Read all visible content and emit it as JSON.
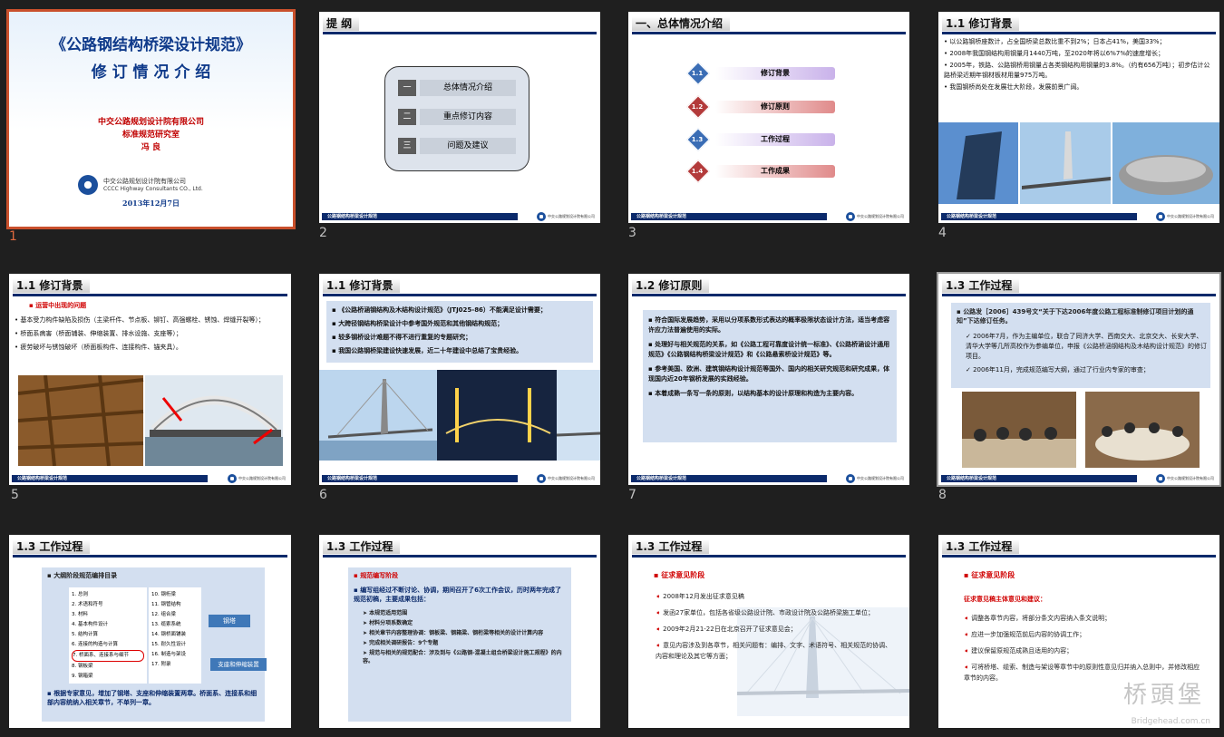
{
  "slides": [
    {
      "num": "1",
      "title": "《公路钢结构桥梁设计规范》",
      "subtitle": "修 订 情 况 介 绍",
      "org1": "中交公路规划设计院有限公司",
      "org2": "标准规范研究室",
      "author": "冯  良",
      "logo_cn": "中交公路规划设计院有限公司",
      "logo_en": "CCCC Highway Consultants CO., Ltd.",
      "date": "2013年12月7日"
    },
    {
      "num": "2",
      "title": "提   纲",
      "items": [
        {
          "n": "一",
          "t": "总体情况介绍"
        },
        {
          "n": "二",
          "t": "重点修订内容"
        },
        {
          "n": "三",
          "t": "问题及建议"
        }
      ]
    },
    {
      "num": "3",
      "title": "一、总体情况介绍",
      "items": [
        {
          "n": "1.1",
          "t": "修订背景"
        },
        {
          "n": "1.2",
          "t": "修订原则"
        },
        {
          "n": "1.3",
          "t": "工作过程"
        },
        {
          "n": "1.4",
          "t": "工作成果"
        }
      ]
    },
    {
      "num": "4",
      "title": "1.1 修订背景",
      "bullets": [
        "以公路钢桥座数计，占全国桥梁总数比重不到2%；日本占41%，美国33%；",
        "2008年我国钢结构用钢量月1440万吨，至2020年将以6%7%的速度增长；",
        "2005年，铁路、公路钢桥用钢量占各类钢结构用钢量的3.8%。（约有656万吨）；初步估计公路桥梁近期年钢材板材用量975万吨。",
        "我国钢桥尚处在发展壮大阶段，发展前景广阔。"
      ]
    },
    {
      "num": "5",
      "title": "1.1 修订背景",
      "head": "运营中出现的问题",
      "bullets": [
        "基本受力构件缺陷及损伤（主梁杆件、节点板、铆钉、高强螺栓、锈蚀、焊缝开裂等）；",
        "桥面系病害（桥面铺装、伸缩装置、排水设施、支座等）；",
        "疲劳破坏与锈蚀破坏（桥面板构件、连接构件、锚夹具）。"
      ]
    },
    {
      "num": "6",
      "title": "1.1 修订背景",
      "bullets": [
        "《公路桥涵钢结构及木结构设计规范》（JTJ025-86）不能满足设计需要；",
        "大跨径钢结构桥梁设计中参考国外规范和其他钢结构规范；",
        "较多钢桥设计难题不得不进行重复的专题研究；",
        "我国公路钢桥梁建设快速发展，近二十年建设中总结了宝贵经验。"
      ]
    },
    {
      "num": "7",
      "title": "1.2 修订原则",
      "bullets": [
        "符合国际发展趋势，采用以分项系数形式表达的概率极限状态设计方法，适当考虑容许应力法普遍使用的实际。",
        "处理好与相关规范的关系，如《公路工程可靠度设计统一标准》、《公路桥涵设计通用规范》《公路钢结构桥梁设计规范》和《公路悬索桥设计规范》等。",
        "参考美国、欧洲、建筑钢结构设计规范等国外、国内的相关研究规范和研究成果，体现国内近20年钢桥发展的实践经验。",
        "本着成熟一条写一条的原则，以结构基本的设计原理和构造为主要内容。"
      ]
    },
    {
      "num": "8",
      "title": "1.3 工作过程",
      "lead": "公路发［2006］439号文“关于下达2006年度公路工程标准制修订项目计划的通知”下达修订任务。",
      "checks": [
        "2006年7月，作为主编单位，联合了同济大学、西南交大、北京交大、长安大学、清华大学等几所高校作为参编单位，申报《公路桥涵钢结构及木结构设计规范》的修订项目。",
        "2006年11月，完成规范编写大纲，通过了行业内专家的审查；"
      ]
    },
    {
      "num": "9",
      "title": "1.3 工作过程",
      "head": "大纲阶段规范编排目录",
      "col1": [
        "1.  总则",
        "2.  术语和符号",
        "3.  材料",
        "4.  基本构件设计",
        "5.  结构计算",
        "6.  连接的构造与计算",
        "7.  桥面系、连接系与细节",
        "8.  钢板梁",
        "9.  钢箱梁"
      ],
      "col2": [
        "10. 钢桁梁",
        "11. 钢管结构",
        "12. 组合梁",
        "13. 缆索系统",
        "14. 钢桥面铺装",
        "15. 耐久性设计",
        "16. 制造与架设",
        "17. 附录"
      ],
      "tag1": "钢塔",
      "tag2": "支座和伸缩装置",
      "note": "根据专家意见，增加了钢塔、支座和伸缩装置两章。桥面系、连接系和细部内容统纳入相关章节，不单列一章。"
    },
    {
      "num": "10",
      "title": "1.3 工作过程",
      "head": "规范编写阶段",
      "lead": "编写组经过不断讨论、协调，期间召开了6次工作会议，历时两年完成了规范初稿，主要成果包括：",
      "items": [
        "本规范适用范围",
        "材料分项系数确定",
        "相关章节内容整理协调：钢板梁、钢箱梁、钢桁梁等相关的设计计算内容",
        "完成相关调研报告：9个专题",
        "规范与相关的规范配合：涉及到与《公路钢-混凝土组合桥梁设计施工规程》的内容。"
      ]
    },
    {
      "num": "11",
      "title": "1.3 工作过程",
      "head": "征求意见阶段",
      "items": [
        "2008年12月发出征求意见稿",
        "发函27家单位，包括各省级公路设计院、市政设计院及公路桥梁施工单位；",
        "2009年2月21-22日在北京召开了征求意见会；",
        "意见内容涉及到各章节，相关问题有：编排、文字、术语符号、相关规范的协调、内容和理论及其它等方面；"
      ]
    },
    {
      "num": "12",
      "title": "1.3 工作过程",
      "head": "征求意见阶段",
      "sub": "征求意见稿主体意见和建议：",
      "items": [
        "调整各章节内容，将部分条文内容纳入条文说明；",
        "应进一步加强规范前后内容的协调工作；",
        "建议保留原规范成熟且适用的内容；",
        "可将桥塔、缆索、制造与架设等章节中的原则性意见归并纳入总则中，并修改相应章节的内容。"
      ]
    }
  ],
  "footer": {
    "left": "公路钢结构桥梁设计规范",
    "logo": "中交公路规划设计院有限公司"
  },
  "watermark": {
    "cn": "桥頭堡",
    "en": "Bridgehead.com.cn"
  }
}
